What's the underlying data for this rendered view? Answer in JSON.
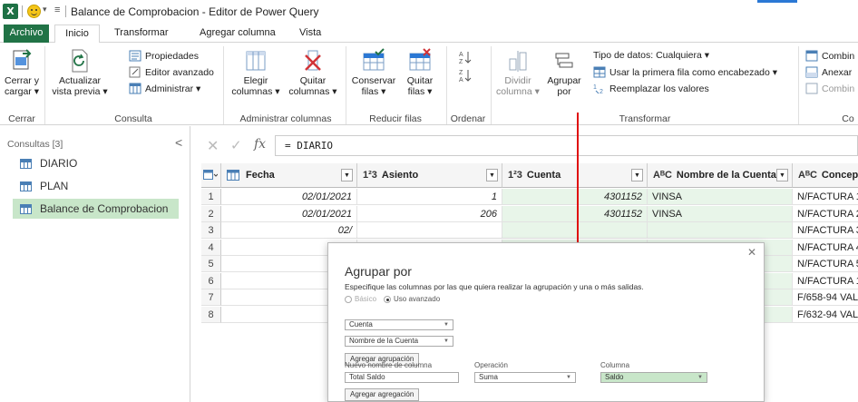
{
  "window": {
    "app_logo": "X",
    "title": "Balance de Comprobacion - Editor de Power Query"
  },
  "tabs": [
    "Archivo",
    "Inicio",
    "Transformar",
    "Agregar columna",
    "Vista"
  ],
  "ribbon": {
    "cerrar": {
      "button_line1": "Cerrar y",
      "button_line2": "cargar ▾",
      "group": "Cerrar"
    },
    "consulta": {
      "refresh_line1": "Actualizar",
      "refresh_line2": "vista previa ▾",
      "propiedades": "Propiedades",
      "editor_avanzado": "Editor avanzado",
      "administrar": "Administrar ▾",
      "group": "Consulta"
    },
    "administrar_columnas": {
      "elegir_line1": "Elegir",
      "elegir_line2": "columnas ▾",
      "quitar_line1": "Quitar",
      "quitar_line2": "columnas ▾",
      "group": "Administrar columnas"
    },
    "reducir_filas": {
      "conservar_line1": "Conservar",
      "conservar_line2": "filas ▾",
      "quitar_line1": "Quitar",
      "quitar_line2": "filas ▾",
      "group": "Reducir filas"
    },
    "ordenar": {
      "group": "Ordenar"
    },
    "transformar": {
      "dividir_line1": "Dividir",
      "dividir_line2": "columna ▾",
      "agrupar_line1": "Agrupar",
      "agrupar_line2": "por",
      "tipo_datos": "Tipo de datos: Cualquiera ▾",
      "primera_fila": "Usar la primera fila como encabezado ▾",
      "reemplazar": "Reemplazar los valores",
      "group": "Transformar"
    },
    "combinar": {
      "combinar1": "Combin",
      "anexar": "Anexar",
      "combinar2": "Combin",
      "group": "Co"
    }
  },
  "queries": {
    "header": "Consultas [3]",
    "collapse": "<",
    "items": [
      "DIARIO",
      "PLAN",
      "Balance de Comprobacion"
    ]
  },
  "formula": {
    "cancel": "✕",
    "confirm": "✓",
    "fx": "fx",
    "text": "= DIARIO"
  },
  "grid": {
    "columns": [
      {
        "type": "",
        "name": "Fecha"
      },
      {
        "type": "1²3",
        "name": "Asiento"
      },
      {
        "type": "1²3",
        "name": "Cuenta"
      },
      {
        "type": "AᴮC",
        "name": "Nombre de la Cuenta"
      },
      {
        "type": "AᴮC",
        "name": "Concepto"
      }
    ],
    "rows": [
      {
        "n": "1",
        "fecha": "02/01/2021",
        "asiento": "1",
        "cuenta": "4301152",
        "nombre": "VINSA",
        "concepto": "N/FACTURA 1"
      },
      {
        "n": "2",
        "fecha": "02/01/2021",
        "asiento": "206",
        "cuenta": "4301152",
        "nombre": "VINSA",
        "concepto": "N/FACTURA 2"
      },
      {
        "n": "3",
        "fecha": "02/",
        "asiento": "",
        "cuenta": "",
        "nombre": "",
        "concepto": "N/FACTURA 3"
      },
      {
        "n": "4",
        "fecha": "02/",
        "asiento": "",
        "cuenta": "",
        "nombre": "",
        "concepto": "N/FACTURA 4"
      },
      {
        "n": "5",
        "fecha": "02/",
        "asiento": "",
        "cuenta": "",
        "nombre": "",
        "concepto": "N/FACTURA 5"
      },
      {
        "n": "6",
        "fecha": "31/",
        "asiento": "",
        "cuenta": "",
        "nombre": "",
        "concepto": "N/FACTURA 1"
      },
      {
        "n": "7",
        "fecha": "28/",
        "asiento": "",
        "cuenta": "",
        "nombre": "",
        "concepto": "F/658-94 VAL"
      },
      {
        "n": "8",
        "fecha": "28/",
        "asiento": "",
        "cuenta": "",
        "nombre": "",
        "concepto": "F/632-94 VAL"
      }
    ]
  },
  "dialog": {
    "title": "Agrupar por",
    "close": "✕",
    "description": "Especifique las columnas por las que quiera realizar la agrupación y una o más salidas.",
    "radio_basic": "Básico",
    "radio_advanced": "Uso avanzado",
    "group_field_1": "Cuenta",
    "group_field_2": "Nombre de la Cuenta",
    "add_grouping": "Agregar agrupación",
    "col_new_name_label": "Nuevo nombre de columna",
    "col_operation_label": "Operación",
    "col_column_label": "Columna",
    "new_name_value": "Total Saldo",
    "operation_value": "Suma",
    "column_value": "Saldo",
    "add_aggregation": "Agregar agregación"
  },
  "colors": {
    "excel_green": "#217346",
    "selection_green": "#c8e6c9",
    "arrow_red": "#e01010"
  }
}
